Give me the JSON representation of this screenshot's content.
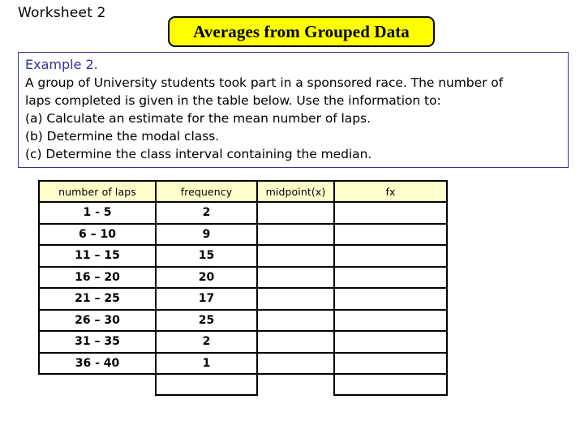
{
  "worksheet_label": "Worksheet 2",
  "title_banner": {
    "text": "Averages from Grouped Data",
    "background_color": "#ffff00",
    "border_color": "#000000",
    "text_color": "#000000"
  },
  "example_box": {
    "border_color": "#333399",
    "heading": "Example 2.",
    "heading_color": "#333399",
    "lines": [
      "A group of University students took part in a sponsored race. The number of",
      "laps completed is given in the table below. Use the information to:",
      "(a) Calculate an estimate for the mean number of laps.",
      "(b) Determine the modal class.",
      "(c) Determine the class interval containing the median."
    ]
  },
  "table": {
    "header_background": "#ffffcc",
    "headers": [
      "number of laps",
      "frequency",
      "midpoint(x)",
      "fx"
    ],
    "rows": [
      {
        "laps": "1 - 5",
        "frequency": "2",
        "midpoint": "",
        "fx": ""
      },
      {
        "laps": "6 – 10",
        "frequency": "9",
        "midpoint": "",
        "fx": ""
      },
      {
        "laps": "11 – 15",
        "frequency": "15",
        "midpoint": "",
        "fx": ""
      },
      {
        "laps": "16 – 20",
        "frequency": "20",
        "midpoint": "",
        "fx": ""
      },
      {
        "laps": "21 – 25",
        "frequency": "17",
        "midpoint": "",
        "fx": ""
      },
      {
        "laps": "26 – 30",
        "frequency": "25",
        "midpoint": "",
        "fx": ""
      },
      {
        "laps": "31 – 35",
        "frequency": "2",
        "midpoint": "",
        "fx": ""
      },
      {
        "laps": "36 - 40",
        "frequency": "1",
        "midpoint": "",
        "fx": ""
      }
    ],
    "summary_row": {
      "laps": "",
      "frequency": "",
      "midpoint": "",
      "fx": ""
    }
  }
}
